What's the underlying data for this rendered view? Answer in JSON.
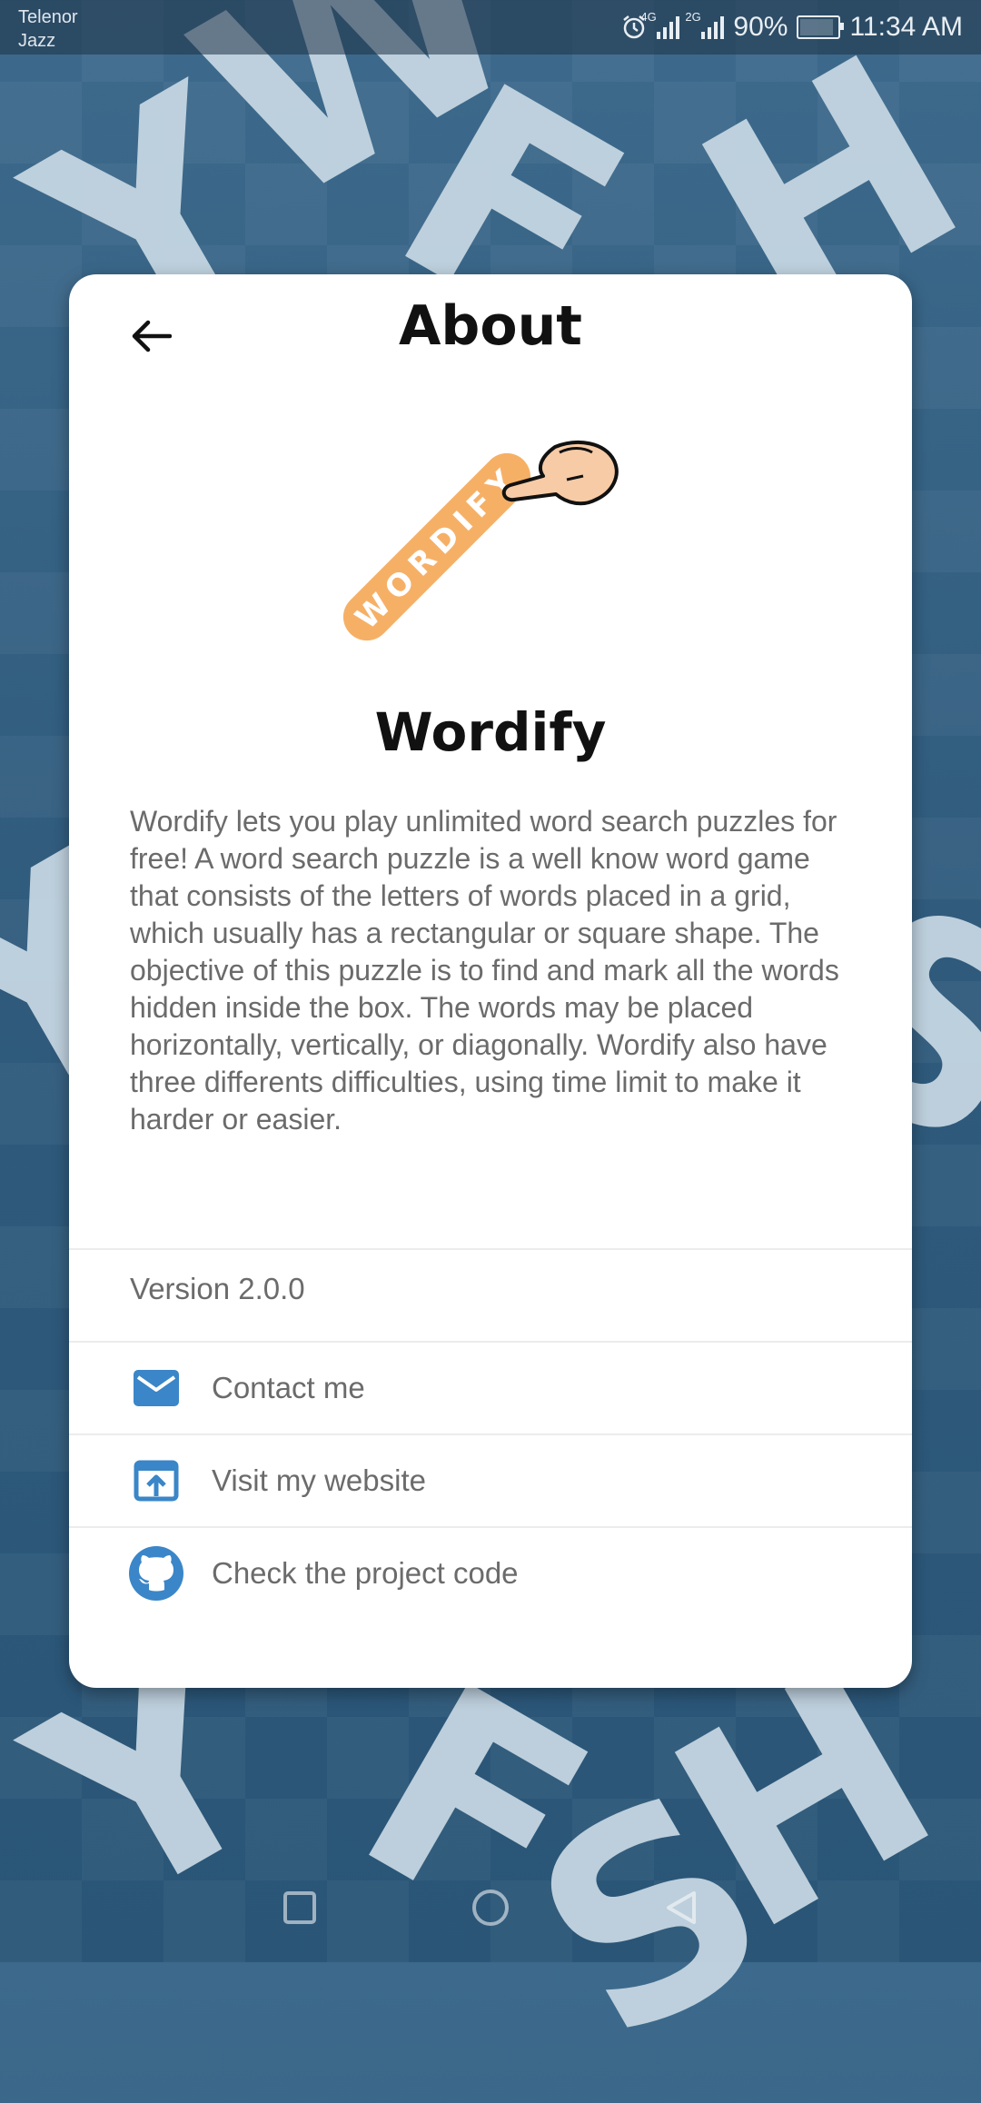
{
  "status_bar": {
    "carrier_line1": "Telenor",
    "carrier_line2": "Jazz",
    "net1": "4G",
    "net2": "2G",
    "battery": "90%",
    "time": "11:34 AM"
  },
  "background": {
    "letters": [
      "Y",
      "W",
      "F",
      "H",
      "Y",
      "S",
      "Y",
      "F",
      "H",
      "S"
    ]
  },
  "about": {
    "title": "About",
    "logo_text": "WORDIFY",
    "app_name": "Wordify",
    "description": "Wordify lets you play unlimited word search puzzles for free! A word search puzzle is a well know word game that consists of the letters of words placed in a grid, which usually has a rectangular or square shape. The objective of this puzzle is to find and mark all the words hidden inside the box. The words may be placed horizontally, vertically, or diagonally. Wordify also have three differents difficulties, using time limit to make it harder or easier.",
    "version": "Version 2.0.0",
    "links": {
      "contact": "Contact me",
      "website": "Visit my website",
      "code": "Check the project code"
    }
  },
  "colors": {
    "accent_blue": "#3a86c8",
    "logo_orange": "#f6b066",
    "card_bg": "#ffffff"
  },
  "icons": {
    "back": "arrow-left-icon",
    "contact": "mail-icon",
    "website": "open-external-icon",
    "code": "github-icon"
  }
}
